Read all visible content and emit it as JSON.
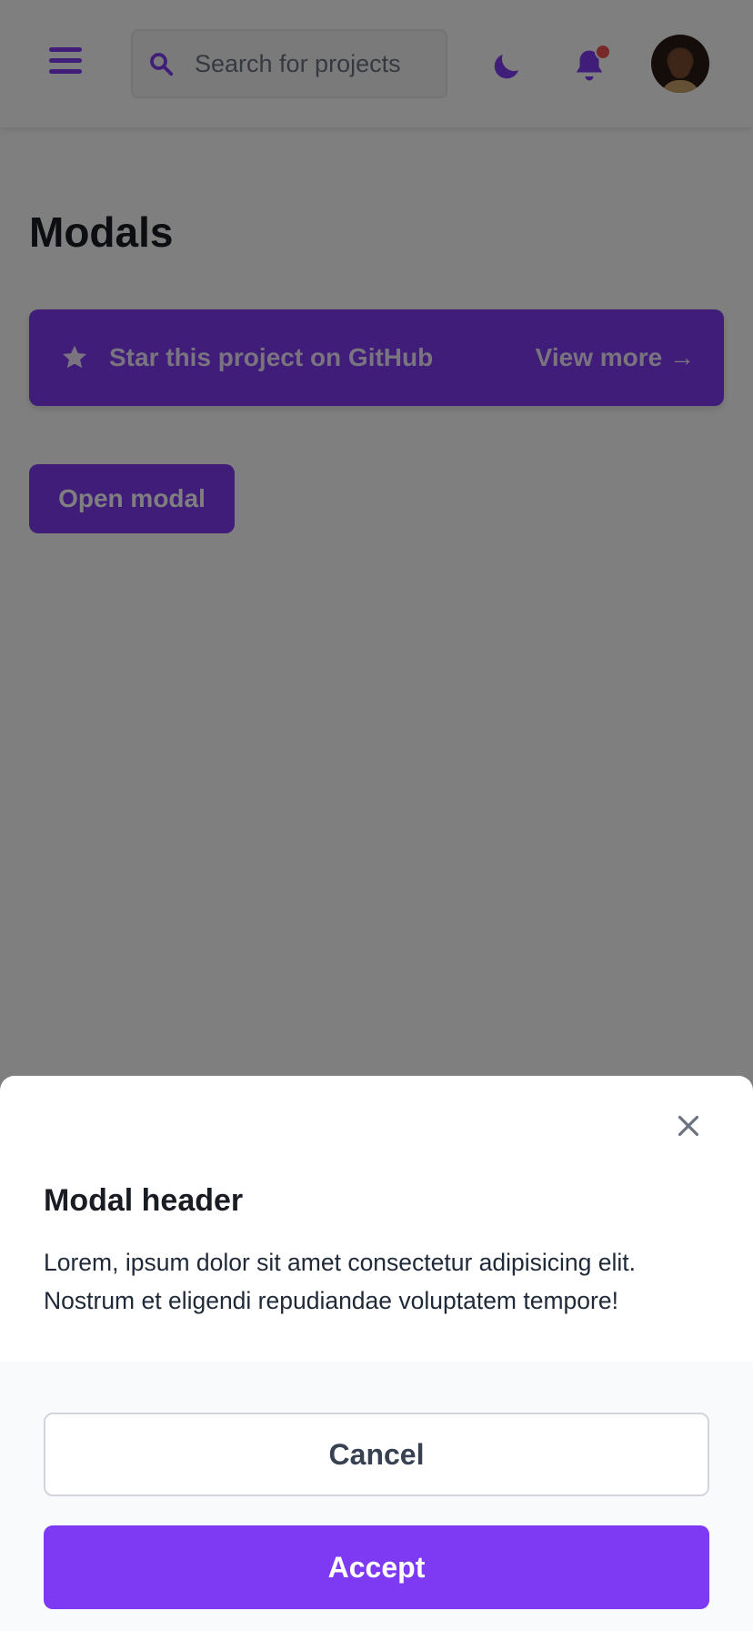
{
  "header": {
    "search_placeholder": "Search for projects",
    "notification_indicator": true
  },
  "page": {
    "title": "Modals"
  },
  "banner": {
    "text": "Star this project on GitHub",
    "link": "View more →"
  },
  "actions": {
    "open_modal_label": "Open modal"
  },
  "modal": {
    "title": "Modal header",
    "body": "Lorem, ipsum dolor sit amet consectetur adipisicing elit. Nostrum et eligendi repudiandae voluptatem tempore!",
    "cancel_label": "Cancel",
    "accept_label": "Accept"
  },
  "colors": {
    "accent": "#7e3af2",
    "backdrop": "rgba(0,0,0,0.5)",
    "notification": "#f05252"
  },
  "icons": [
    "menu-icon",
    "search-icon",
    "moon-icon",
    "bell-icon",
    "star-icon",
    "close-icon"
  ]
}
